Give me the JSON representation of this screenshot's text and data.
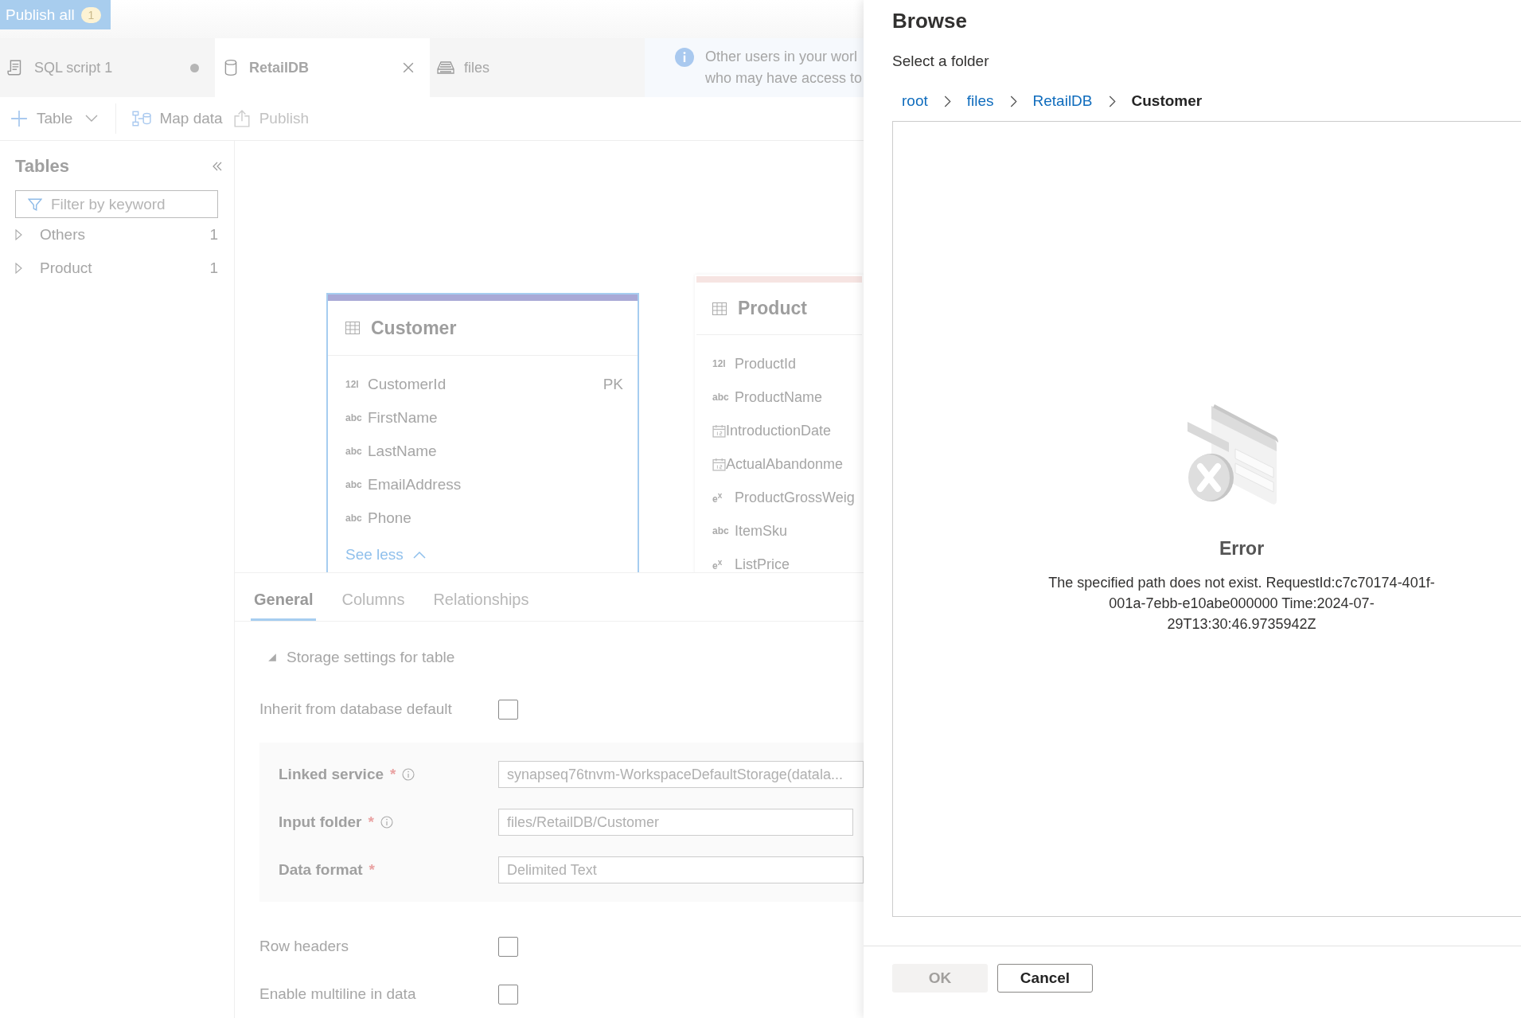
{
  "publish_all": {
    "label": "Publish all",
    "badge": "1"
  },
  "tabs": [
    {
      "label": "SQL script 1",
      "kind": "script",
      "selected": false,
      "unsaved": true
    },
    {
      "label": "RetailDB",
      "kind": "database",
      "selected": true,
      "closable": true
    },
    {
      "label": "files",
      "kind": "storage",
      "selected": false
    }
  ],
  "info_banner": {
    "lines": [
      "Other users in your worl",
      "who may have access to"
    ]
  },
  "toolbar": [
    {
      "label": "Table",
      "kind": "add",
      "dropdown": true
    },
    {
      "label": "Map data",
      "kind": "map"
    },
    {
      "label": "Publish",
      "kind": "publish",
      "disabled": true
    }
  ],
  "sidebar": {
    "title": "Tables",
    "filter": {
      "placeholder": "Filter by keyword"
    },
    "items": [
      {
        "label": "Others",
        "count": "1",
        "expanded": false
      },
      {
        "label": "Product",
        "count": "1",
        "expanded": false
      }
    ]
  },
  "canvas": {
    "tables": [
      {
        "name": "Customer",
        "selected": true,
        "color": "#a9a9d6",
        "columns": [
          {
            "name": "CustomerId",
            "kind": "glyph",
            "glyph": "12l",
            "key": "PK"
          },
          {
            "name": "FirstName",
            "kind": "glyph",
            "glyph": "abc"
          },
          {
            "name": "LastName",
            "kind": "glyph",
            "glyph": "abc"
          },
          {
            "name": "EmailAddress",
            "kind": "glyph",
            "glyph": "abc"
          },
          {
            "name": "Phone",
            "kind": "glyph",
            "glyph": "abc"
          }
        ],
        "toggle": {
          "label": "See less",
          "expanded": true
        }
      },
      {
        "name": "Product",
        "selected": false,
        "color": "#f6e4e2",
        "columns": [
          {
            "name": "ProductId",
            "kind": "glyph",
            "glyph": "12l"
          },
          {
            "name": "ProductName",
            "kind": "glyph",
            "glyph": "abc"
          },
          {
            "name": "IntroductionDate",
            "kind": "calendar"
          },
          {
            "name": "ActualAbandonme",
            "kind": "calendar"
          },
          {
            "name": "ProductGrossWeig",
            "kind": "glyph",
            "glyph": "e$^{x}$"
          },
          {
            "name": "ItemSku",
            "kind": "glyph",
            "glyph": "abc"
          },
          {
            "name": "ListPrice",
            "kind": "glyph",
            "glyph": "e$^{x}$"
          }
        ]
      }
    ]
  },
  "detail_tabs": [
    {
      "label": "General",
      "selected": true
    },
    {
      "label": "Columns",
      "selected": false
    },
    {
      "label": "Relationships",
      "selected": false
    }
  ],
  "storage_section": {
    "title": "Storage settings for table",
    "expanded": true
  },
  "form": [
    {
      "kind": "checkbox",
      "label": "Inherit from database default",
      "checked": false
    },
    {
      "kind": "group",
      "fields": [
        {
          "label": "Linked service",
          "required_mark": "*",
          "info": true,
          "value": "synapseq76tnvm-WorkspaceDefaultStorage(datala..."
        },
        {
          "label": "Input folder",
          "required_mark": "*",
          "info": true,
          "value": "files/RetailDB/Customer"
        },
        {
          "label": "Data format",
          "required_mark": "*",
          "value": "Delimited Text"
        }
      ]
    },
    {
      "kind": "checkbox",
      "label": "Row headers",
      "checked": false
    },
    {
      "kind": "checkbox",
      "label": "Enable multiline in data",
      "checked": false
    }
  ],
  "browse": {
    "title": "Browse",
    "subtitle": "Select a folder",
    "breadcrumb": [
      {
        "label": "root",
        "current": false
      },
      {
        "label": "files",
        "current": false
      },
      {
        "label": "RetailDB",
        "current": false
      },
      {
        "label": "Customer",
        "current": true
      }
    ],
    "error": {
      "title": "Error",
      "message": "The specified path does not exist. RequestId:c7c70174-401f-001a-7ebb-e10abe000000 Time:2024-07-29T13:30:46.9735942Z"
    },
    "buttons": [
      {
        "label": "OK",
        "kind": "primary",
        "disabled": true
      },
      {
        "label": "Cancel",
        "kind": "default"
      }
    ]
  }
}
